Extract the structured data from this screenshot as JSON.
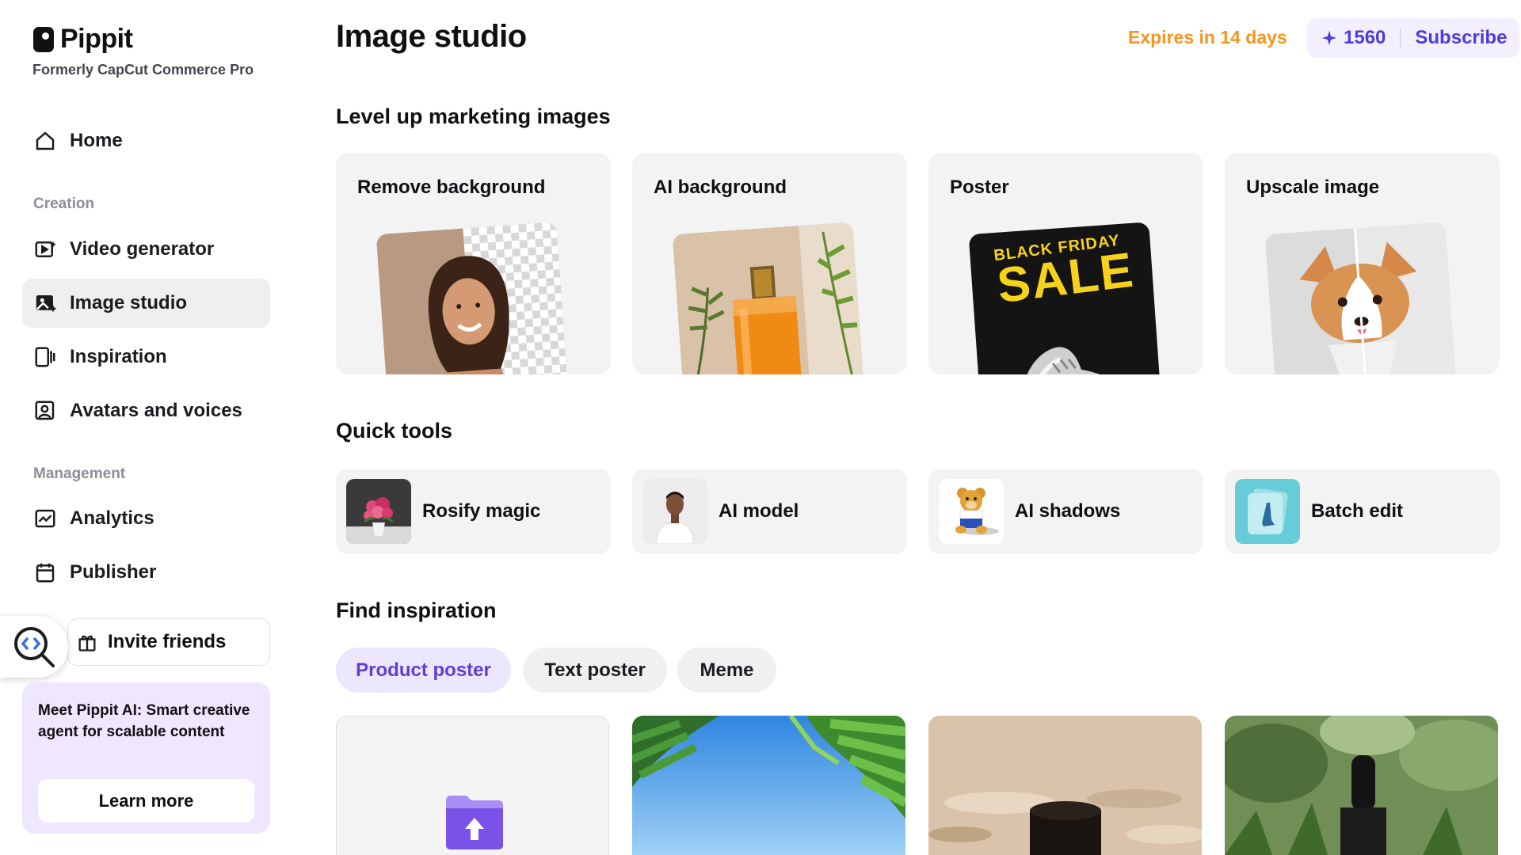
{
  "brand": {
    "name": "Pippit",
    "subtitle": "Formerly CapCut Commerce Pro"
  },
  "sidebar": {
    "home": "Home",
    "creation_label": "Creation",
    "items": [
      {
        "label": "Video generator",
        "icon": "video-generator-icon"
      },
      {
        "label": "Image studio",
        "icon": "image-studio-icon",
        "active": true
      },
      {
        "label": "Inspiration",
        "icon": "inspiration-icon"
      },
      {
        "label": "Avatars and voices",
        "icon": "avatar-icon"
      }
    ],
    "management_label": "Management",
    "management_items": [
      {
        "label": "Analytics",
        "icon": "analytics-icon"
      },
      {
        "label": "Publisher",
        "icon": "calendar-icon"
      }
    ],
    "invite": "Invite friends",
    "promo": {
      "text": "Meet Pippit AI: Smart creative agent for scalable content",
      "button": "Learn more"
    }
  },
  "header": {
    "title": "Image studio",
    "expires": "Expires in 14 days",
    "credits": "1560",
    "subscribe": "Subscribe"
  },
  "sections": {
    "level_up": "Level up marketing images",
    "quick_tools": "Quick tools",
    "find_inspiration": "Find inspiration"
  },
  "feature_cards": [
    {
      "label": "Remove background"
    },
    {
      "label": "AI background"
    },
    {
      "label": "Poster",
      "poster_text_top": "BLACK FRIDAY",
      "poster_text_main": "SALE"
    },
    {
      "label": "Upscale image"
    }
  ],
  "quick_tools": [
    {
      "label": "Rosify magic"
    },
    {
      "label": "AI model"
    },
    {
      "label": "AI shadows"
    },
    {
      "label": "Batch edit"
    }
  ],
  "inspiration_tabs": [
    {
      "label": "Product poster",
      "active": true
    },
    {
      "label": "Text poster"
    },
    {
      "label": "Meme"
    }
  ],
  "colors": {
    "accent": "#5b3fd0",
    "expires": "#f5951d",
    "card_bg": "#f3f3f4"
  }
}
